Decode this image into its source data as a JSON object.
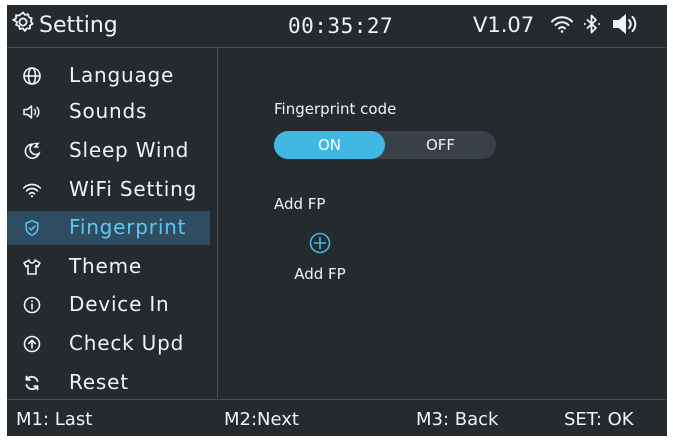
{
  "header": {
    "title": "Setting",
    "time": "00:35:27",
    "version": "V1.07",
    "icons": [
      "gear-icon",
      "wifi-icon",
      "bluetooth-icon",
      "speaker-icon"
    ]
  },
  "sidebar": {
    "items": [
      {
        "label": "Language",
        "icon": "globe-icon"
      },
      {
        "label": "Sounds",
        "icon": "speaker-outline-icon"
      },
      {
        "label": "Sleep Wind",
        "icon": "moon-sleep-icon"
      },
      {
        "label": "WiFi Setting",
        "icon": "wifi-icon"
      },
      {
        "label": "Fingerprint",
        "icon": "shield-check-icon",
        "active": true
      },
      {
        "label": "Theme",
        "icon": "tshirt-icon"
      },
      {
        "label": "Device In",
        "icon": "info-icon"
      },
      {
        "label": "Check Upd",
        "icon": "upload-arrow-icon"
      },
      {
        "label": "Reset",
        "icon": "refresh-icon"
      }
    ]
  },
  "content": {
    "fingerprint_code_label": "Fingerprint code",
    "toggle": {
      "on_label": "ON",
      "off_label": "OFF",
      "selected": "ON"
    },
    "add_fp_heading": "Add FP",
    "add_fp_button_label": "Add FP"
  },
  "footer": {
    "m1": "M1:  Last",
    "m2": "M2:Next",
    "m3": "M3: Back",
    "set": "SET: OK"
  },
  "colors": {
    "background": "#252a2f",
    "accent": "#41b8e2",
    "active_row": "#2f4d60",
    "text": "#f2f2f2"
  }
}
